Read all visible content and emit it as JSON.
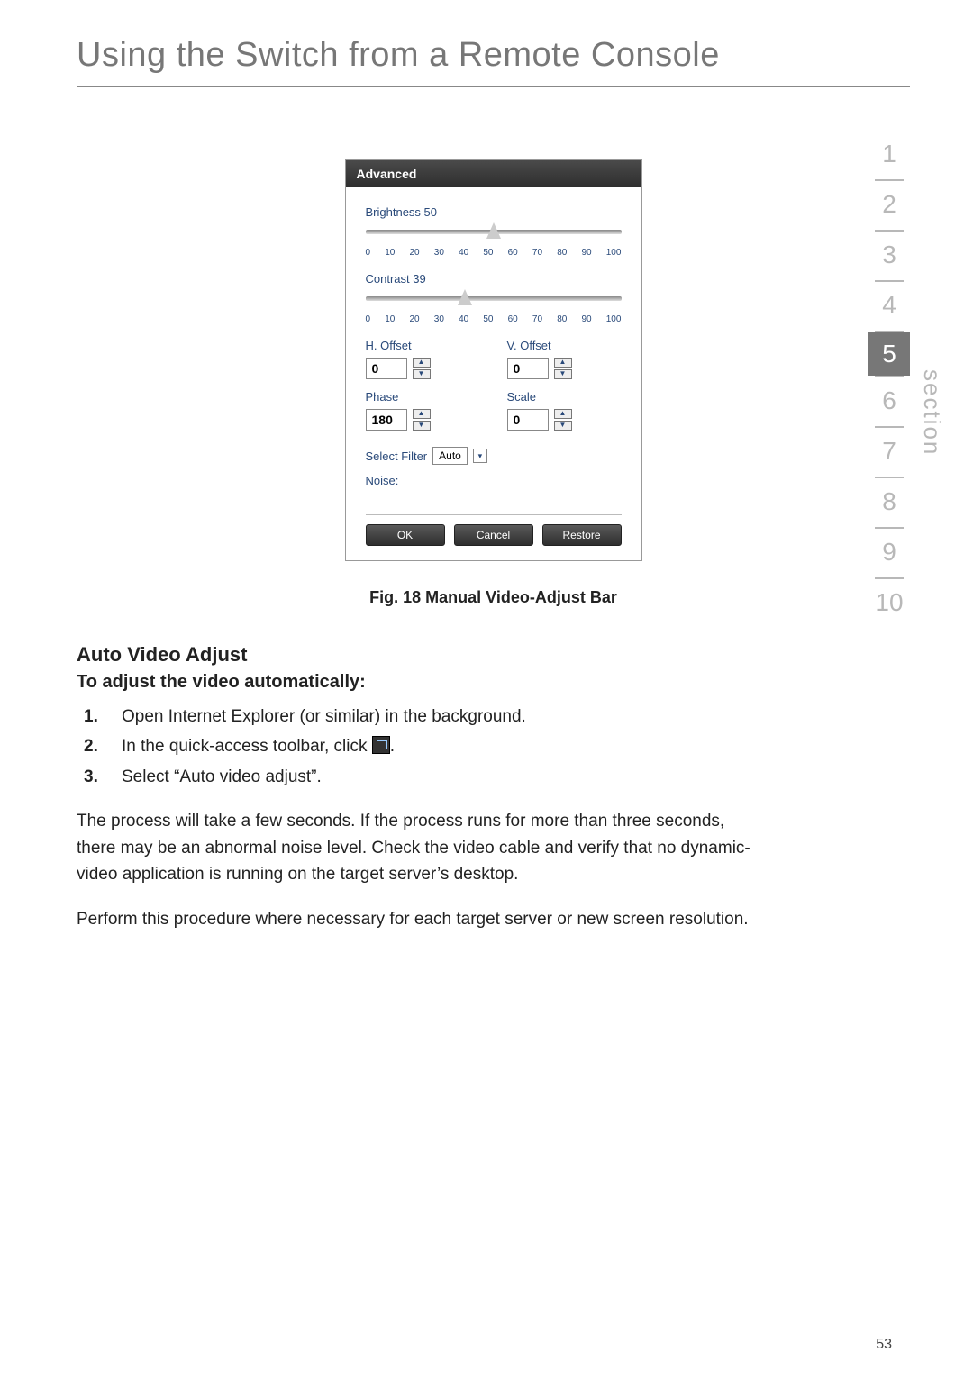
{
  "title": "Using the Switch from a Remote Console",
  "section_label": "section",
  "nav": {
    "items": [
      "1",
      "2",
      "3",
      "4",
      "5",
      "6",
      "7",
      "8",
      "9",
      "10"
    ],
    "active_index": 4
  },
  "dialog": {
    "title": "Advanced",
    "brightness": {
      "label": "Brightness 50",
      "value": 50,
      "ticks": [
        "0",
        "10",
        "20",
        "30",
        "40",
        "50",
        "60",
        "70",
        "80",
        "90",
        "100"
      ]
    },
    "contrast": {
      "label": "Contrast 39",
      "value": 39,
      "ticks": [
        "0",
        "10",
        "20",
        "30",
        "40",
        "50",
        "60",
        "70",
        "80",
        "90",
        "100"
      ]
    },
    "h_offset": {
      "label": "H. Offset",
      "value": "0"
    },
    "v_offset": {
      "label": "V. Offset",
      "value": "0"
    },
    "phase": {
      "label": "Phase",
      "value": "180"
    },
    "scale": {
      "label": "Scale",
      "value": "0"
    },
    "filter": {
      "label": "Select Filter",
      "value": "Auto"
    },
    "noise": {
      "label": "Noise:"
    },
    "buttons": {
      "ok": "OK",
      "cancel": "Cancel",
      "restore": "Restore"
    }
  },
  "caption": "Fig. 18 Manual Video-Adjust Bar",
  "auto_adjust": {
    "heading": "Auto Video Adjust",
    "subheading": "To adjust the video automatically:",
    "steps": [
      {
        "n": "1.",
        "text": "Open Internet Explorer (or similar) in the background."
      },
      {
        "n": "2.",
        "text_before": "In the quick-access toolbar, click ",
        "text_after": "."
      },
      {
        "n": "3.",
        "text": "Select “Auto video adjust”."
      }
    ],
    "para1": "The process will take a few seconds. If the process runs for more than three seconds, there may be an abnormal noise level. Check the video cable and verify that no dynamic-video application is running on the target server’s desktop.",
    "para2": "Perform this procedure where necessary for each target server or new screen resolution."
  },
  "page_number": "53"
}
